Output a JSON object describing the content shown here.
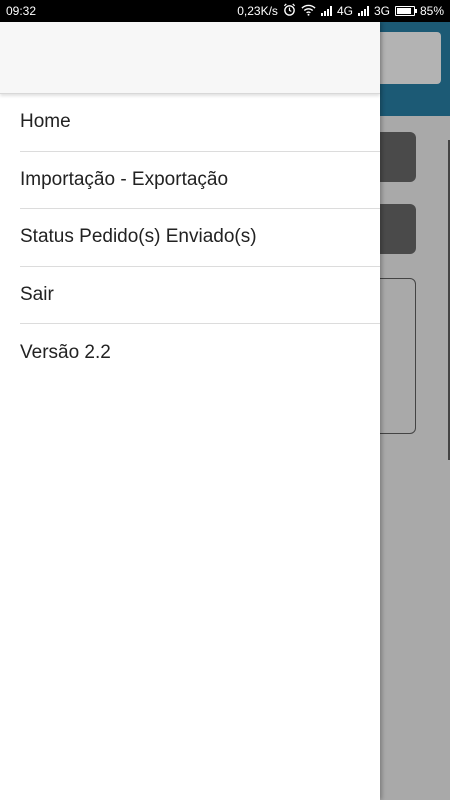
{
  "status_bar": {
    "time": "09:32",
    "speed": "0,23K/s",
    "net1": "4G",
    "net2": "3G",
    "battery": "85%",
    "battery_level": 0.85,
    "icons": [
      "alarm-icon",
      "wifi-icon",
      "signal-icon",
      "battery-icon"
    ]
  },
  "drawer": {
    "menu": [
      {
        "label": "Home"
      },
      {
        "label": "Importação - Exportação"
      },
      {
        "label": "Status Pedido(s) Enviado(s)"
      },
      {
        "label": "Sair"
      },
      {
        "label": "Versão 2.2"
      }
    ]
  },
  "colors": {
    "overlay": "#a9a9a9",
    "header_accent": "#1c5a75",
    "drawer_bg": "#ffffff"
  }
}
